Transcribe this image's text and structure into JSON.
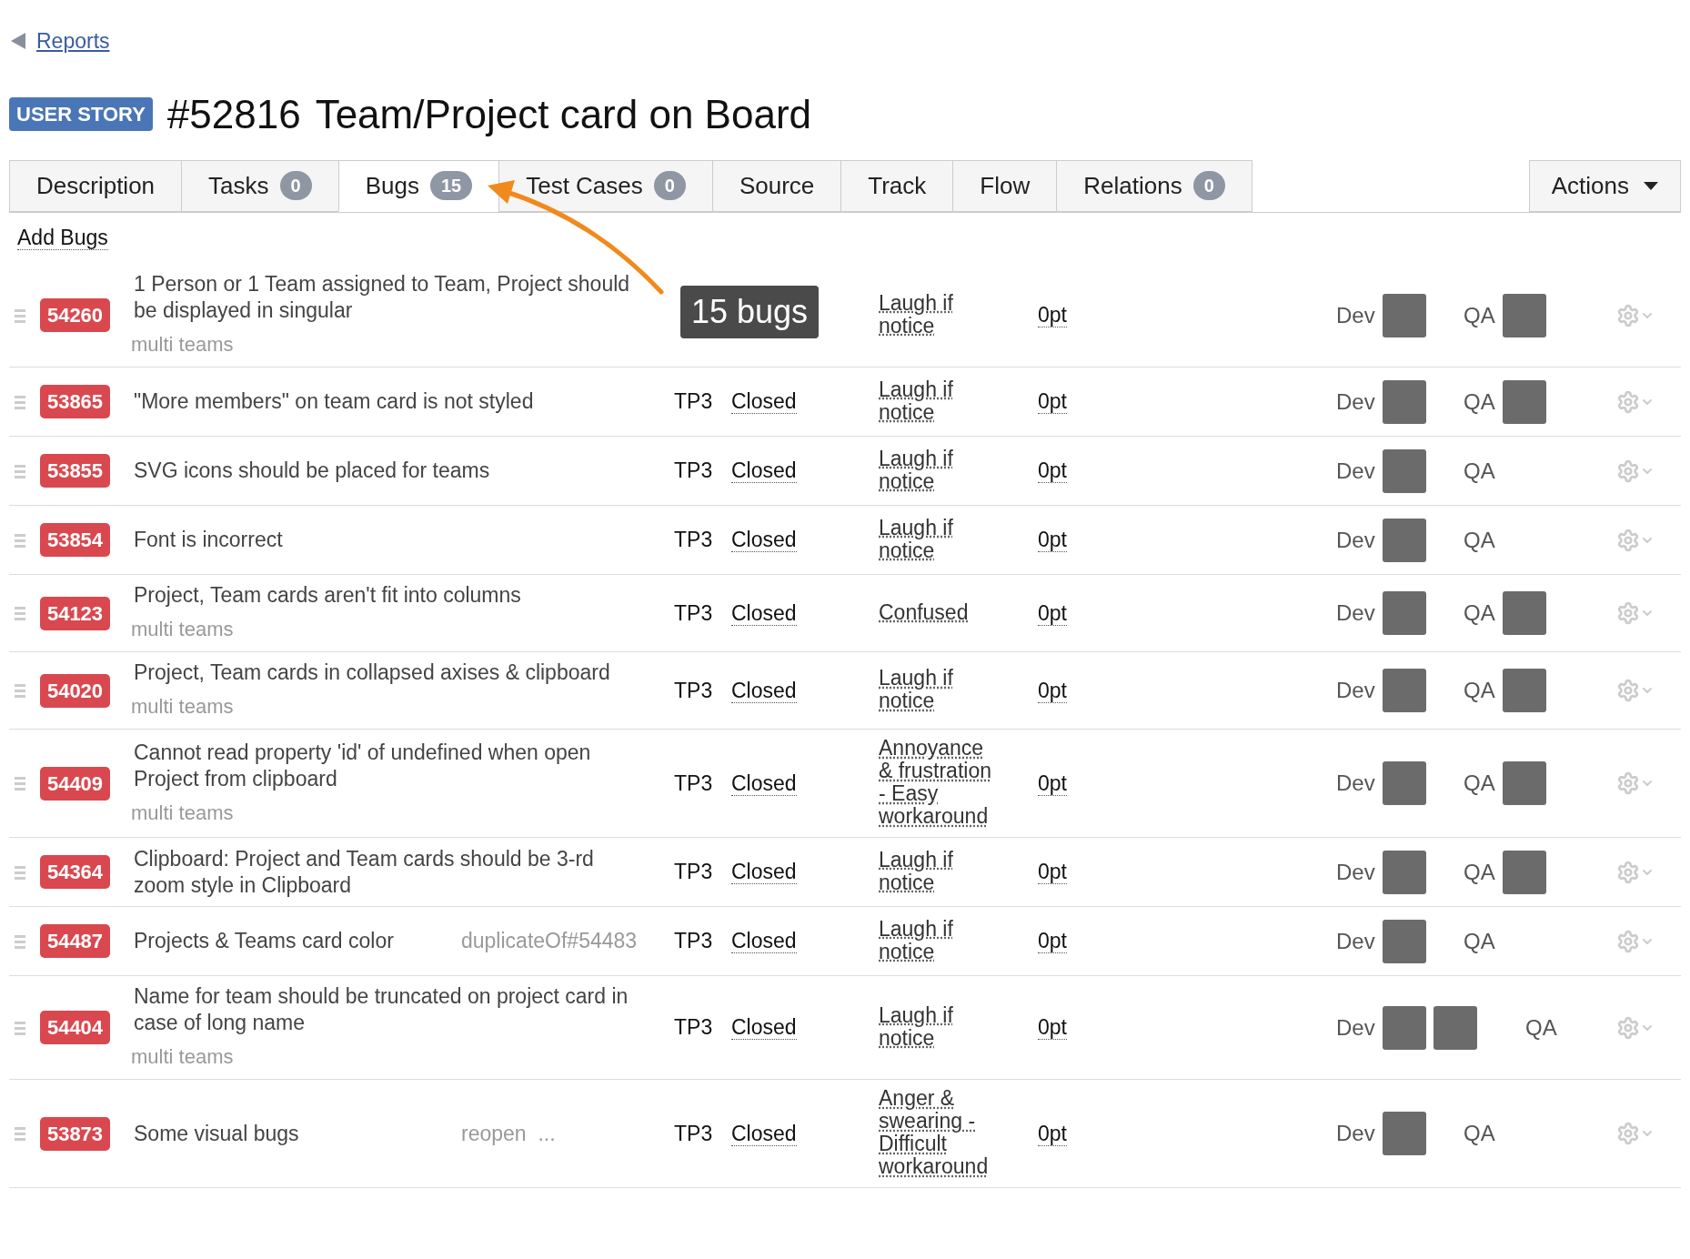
{
  "breadcrumb": {
    "label": "Reports"
  },
  "entity": {
    "type_badge": "USER STORY",
    "id": "#52816",
    "title": "Team/Project card on Board"
  },
  "tabs": [
    {
      "label": "Description",
      "selected": false
    },
    {
      "label": "Tasks",
      "count": "0",
      "selected": false
    },
    {
      "label": "Bugs",
      "count": "15",
      "selected": true
    },
    {
      "label": "Test Cases",
      "count": "0",
      "selected": false
    },
    {
      "label": "Source",
      "selected": false
    },
    {
      "label": "Track",
      "selected": false
    },
    {
      "label": "Flow",
      "selected": false
    },
    {
      "label": "Relations",
      "count": "0",
      "selected": false
    }
  ],
  "actions": {
    "label": "Actions"
  },
  "add_link": "Add Bugs",
  "annotation": {
    "text": "15 bugs"
  },
  "bugs": [
    {
      "id": "54260",
      "title": "1 Person or 1 Team assigned to Team, Project should be displayed in singular",
      "tag": "multi teams",
      "severity": "Laugh if notice",
      "effort": "0pt",
      "dev": {
        "label": "Dev",
        "avatars": [
          {
            "kind": "photo"
          }
        ]
      },
      "qa": {
        "label": "QA",
        "avatars": [
          {
            "kind": "photo"
          }
        ]
      }
    },
    {
      "id": "53865",
      "title": "\"More members\" on team card is not styled",
      "project": "TP3",
      "state": "Closed",
      "severity": "Laugh if notice",
      "effort": "0pt",
      "dev": {
        "label": "Dev",
        "avatars": [
          {
            "kind": "photo"
          }
        ]
      },
      "qa": {
        "label": "QA",
        "avatars": [
          {
            "kind": "photo"
          }
        ]
      }
    },
    {
      "id": "53855",
      "title": "SVG icons should be placed for teams",
      "project": "TP3",
      "state": "Closed",
      "severity": "Laugh if notice",
      "effort": "0pt",
      "dev": {
        "label": "Dev",
        "avatars": [
          {
            "kind": "photo"
          }
        ]
      },
      "qa": {
        "label": "QA"
      }
    },
    {
      "id": "53854",
      "title": "Font is incorrect",
      "project": "TP3",
      "state": "Closed",
      "severity": "Laugh if notice",
      "effort": "0pt",
      "dev": {
        "label": "Dev",
        "avatars": [
          {
            "kind": "photo"
          }
        ]
      },
      "qa": {
        "label": "QA"
      }
    },
    {
      "id": "54123",
      "title": "Project, Team cards aren't fit into columns",
      "tag": "multi teams",
      "project": "TP3",
      "state": "Closed",
      "severity": "Confused",
      "effort": "0pt",
      "dev": {
        "label": "Dev",
        "avatars": [
          {
            "kind": "photo"
          }
        ]
      },
      "qa": {
        "label": "QA",
        "avatars": [
          {
            "kind": "photo"
          }
        ]
      }
    },
    {
      "id": "54020",
      "title": "Project, Team cards in collapsed axises & clipboard",
      "tag": "multi teams",
      "project": "TP3",
      "state": "Closed",
      "severity": "Laugh if notice",
      "effort": "0pt",
      "dev": {
        "label": "Dev",
        "avatars": [
          {
            "kind": "photo"
          }
        ]
      },
      "qa": {
        "label": "QA",
        "avatars": [
          {
            "kind": "photo"
          }
        ]
      }
    },
    {
      "id": "54409",
      "title": "Cannot read property 'id' of undefined when open Project from clipboard",
      "tag": "multi teams",
      "project": "TP3",
      "state": "Closed",
      "severity": "Annoyance & frustration - Easy workaround",
      "effort": "0pt",
      "dev": {
        "label": "Dev",
        "avatars": [
          {
            "kind": "photo"
          }
        ]
      },
      "qa": {
        "label": "QA",
        "avatars": [
          {
            "kind": "photo"
          }
        ]
      }
    },
    {
      "id": "54364",
      "title": "Clipboard: Project and Team cards should be 3-rd zoom style in Clipboard",
      "project": "TP3",
      "state": "Closed",
      "severity": "Laugh if notice",
      "effort": "0pt",
      "dev": {
        "label": "Dev",
        "avatars": [
          {
            "kind": "photo"
          }
        ]
      },
      "qa": {
        "label": "QA",
        "avatars": [
          {
            "kind": "photo"
          }
        ]
      }
    },
    {
      "id": "54487",
      "title": "Projects & Teams card color",
      "note": "duplicateOf#54483",
      "project": "TP3",
      "state": "Closed",
      "severity": "Laugh if notice",
      "effort": "0pt",
      "dev": {
        "label": "Dev",
        "avatars": [
          {
            "kind": "photo"
          }
        ]
      },
      "qa": {
        "label": "QA"
      }
    },
    {
      "id": "54404",
      "title": "Name for team should be truncated on project card in case of long name",
      "tag": "multi teams",
      "project": "TP3",
      "state": "Closed",
      "severity": "Laugh if notice",
      "effort": "0pt",
      "dev": {
        "label": "Dev",
        "avatars": [
          {
            "kind": "photo"
          },
          {
            "kind": "photo"
          }
        ]
      },
      "qa": {
        "label": "QA"
      }
    },
    {
      "id": "53873",
      "title": "Some visual bugs",
      "note": "reopen  ...",
      "project": "TP3",
      "state": "Closed",
      "severity": "Anger & swearing - Difficult workaround",
      "effort": "0pt",
      "dev": {
        "label": "Dev",
        "avatars": [
          {
            "kind": "photo"
          }
        ]
      },
      "qa": {
        "label": "QA"
      }
    }
  ]
}
